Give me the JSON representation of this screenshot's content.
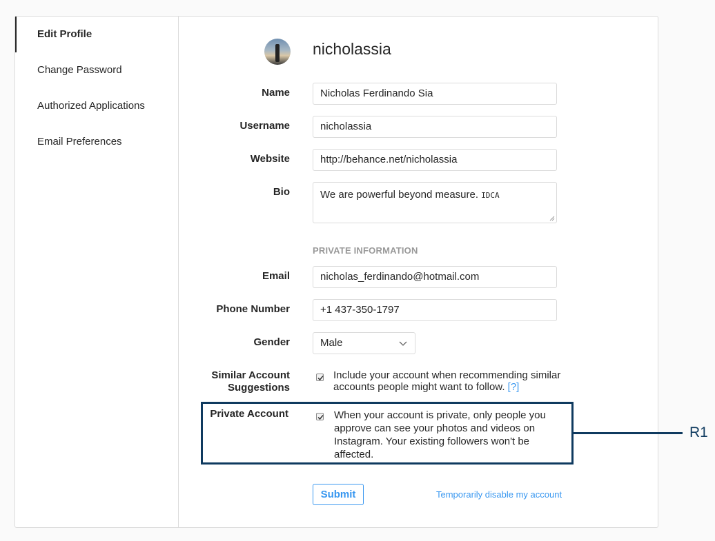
{
  "sidebar": {
    "items": [
      {
        "label": "Edit Profile",
        "active": true
      },
      {
        "label": "Change Password"
      },
      {
        "label": "Authorized Applications"
      },
      {
        "label": "Email Preferences"
      }
    ]
  },
  "profile": {
    "username_heading": "nicholassia"
  },
  "form": {
    "name": {
      "label": "Name",
      "value": "Nicholas Ferdinando Sia"
    },
    "username": {
      "label": "Username",
      "value": "nicholassia"
    },
    "website": {
      "label": "Website",
      "value": "http://behance.net/nicholassia"
    },
    "bio": {
      "label": "Bio",
      "value": "We are powerful beyond measure.",
      "tag": "IDCA"
    },
    "private_info_heading": "PRIVATE INFORMATION",
    "email": {
      "label": "Email",
      "value": "nicholas_ferdinando@hotmail.com"
    },
    "phone": {
      "label": "Phone Number",
      "value": "+1 437-350-1797"
    },
    "gender": {
      "label": "Gender",
      "value": "Male"
    },
    "similar": {
      "label_line1": "Similar Account",
      "label_line2": "Suggestions",
      "checked": true,
      "text_line1": "Include your account when recommending similar",
      "text_line2": "accounts people might want to follow.",
      "help": "[?]"
    },
    "private": {
      "label": "Private Account",
      "checked": true,
      "text_line1": "When your account is private, only people you",
      "text_line2": "approve can see your photos and videos on",
      "text_line3": "Instagram. Your existing followers won't be",
      "text_line4": "affected."
    },
    "submit_label": "Submit",
    "disable_link": "Temporarily disable my account"
  },
  "annotation": {
    "callout_label": "R1",
    "color": "#0f3a5f"
  },
  "colors": {
    "accent": "#3897f0",
    "border": "#dbdbdb",
    "muted": "#999999"
  }
}
